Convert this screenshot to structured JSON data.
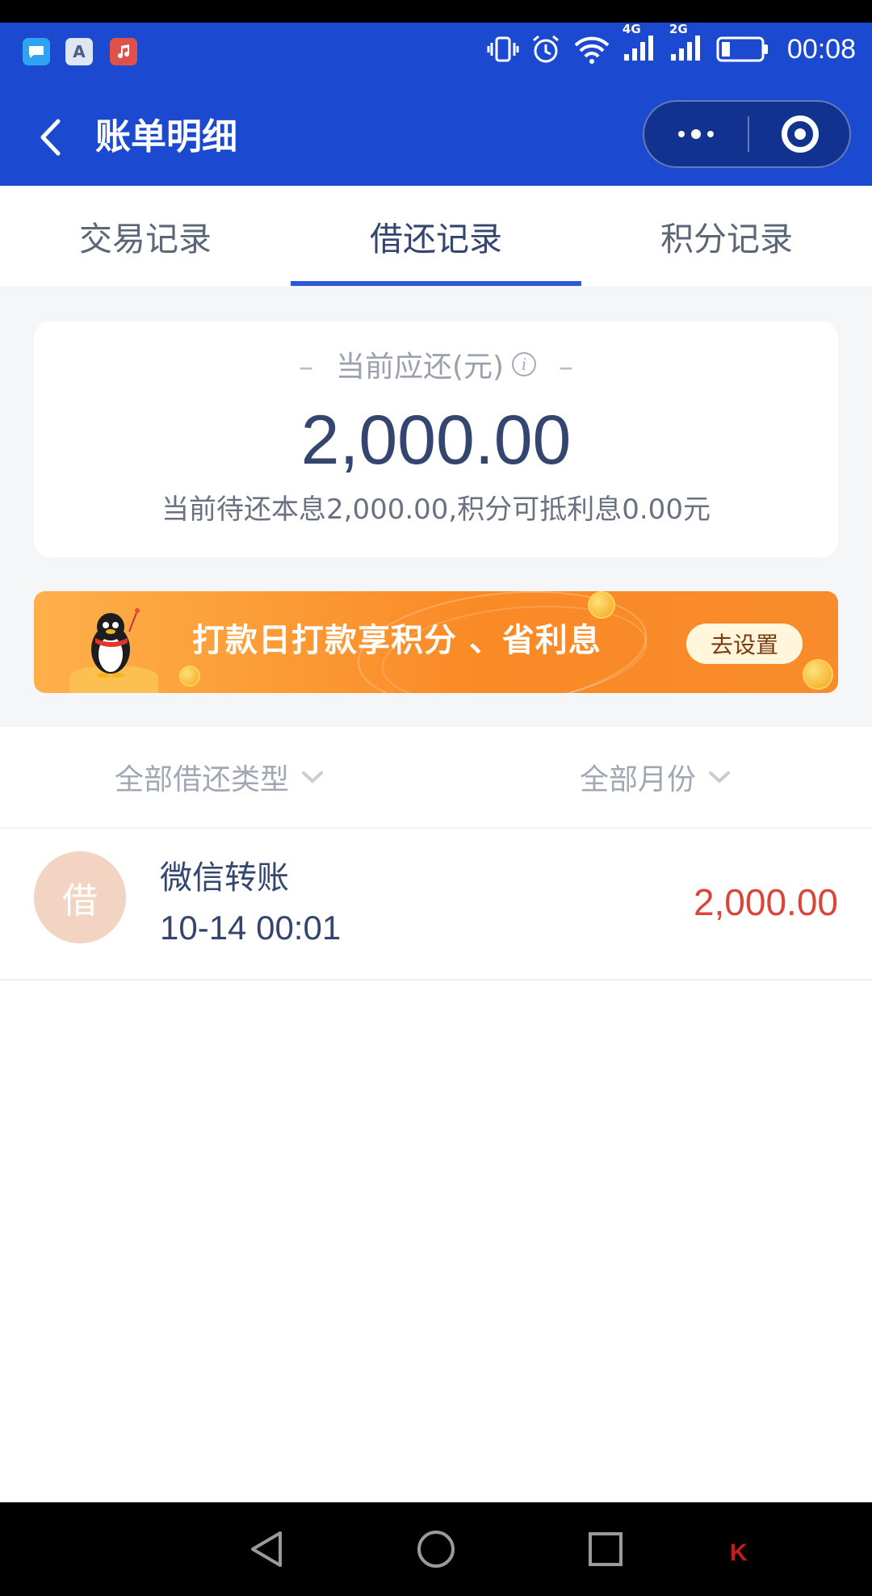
{
  "status_bar": {
    "time": "00:08",
    "network_4g": "4G",
    "network_2g": "2G"
  },
  "nav": {
    "title": "账单明细"
  },
  "tabs": [
    {
      "label": "交易记录",
      "active": false
    },
    {
      "label": "借还记录",
      "active": true
    },
    {
      "label": "积分记录",
      "active": false
    }
  ],
  "due_card": {
    "label": "当前应还(元)",
    "info_icon": "i",
    "amount": "2,000.00",
    "note": "当前待还本息2,000.00,积分可抵利息0.00元"
  },
  "banner": {
    "title": "打款日打款享积分 、省利息",
    "button": "去设置"
  },
  "filters": {
    "type": "全部借还类型",
    "month": "全部月份"
  },
  "records": [
    {
      "avatar": "借",
      "title": "微信转账",
      "time": "10-14 00:01",
      "amount": "2,000.00"
    }
  ],
  "colors": {
    "header_blue": "#1b49cf",
    "tab_underline": "#2c59d9",
    "amount_red": "#d8463a",
    "text_navy": "#34466f",
    "banner_orange": "#fa8a26"
  }
}
